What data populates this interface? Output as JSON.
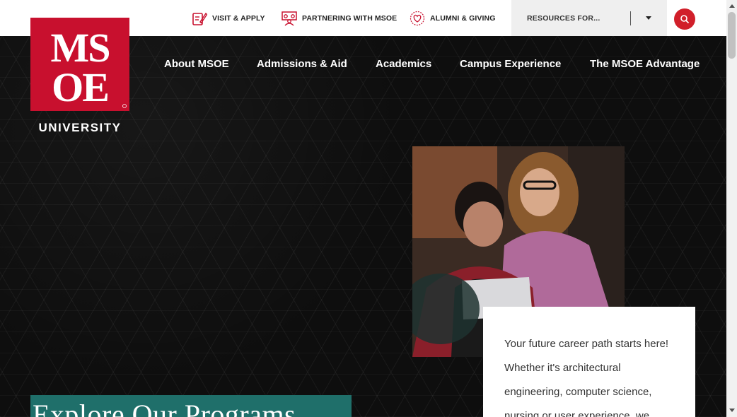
{
  "utility_nav": {
    "items": [
      {
        "label": "VISIT & APPLY",
        "icon": "pencil-checklist-icon"
      },
      {
        "label": "PARTNERING WITH MSOE",
        "icon": "people-group-icon"
      },
      {
        "label": "ALUMNI & GIVING",
        "icon": "heart-badge-icon"
      }
    ],
    "resources_label": "RESOURCES FOR...",
    "search_icon": "search-icon"
  },
  "logo": {
    "mark": "MSOE",
    "university": "UNIVERSITY"
  },
  "main_nav": {
    "items": [
      {
        "label": "About MSOE"
      },
      {
        "label": "Admissions & Aid"
      },
      {
        "label": "Academics"
      },
      {
        "label": "Campus Experience"
      },
      {
        "label": "The MSOE Advantage"
      }
    ]
  },
  "hero": {
    "card_text": "Your future career path starts here! Whether it's architectural engineering, computer science, nursing or user experience, we",
    "heading": "Explore Our Programs"
  },
  "colors": {
    "brand_red": "#c8102e",
    "teal": "#1f6f6a",
    "background": "#0e0e0e"
  }
}
